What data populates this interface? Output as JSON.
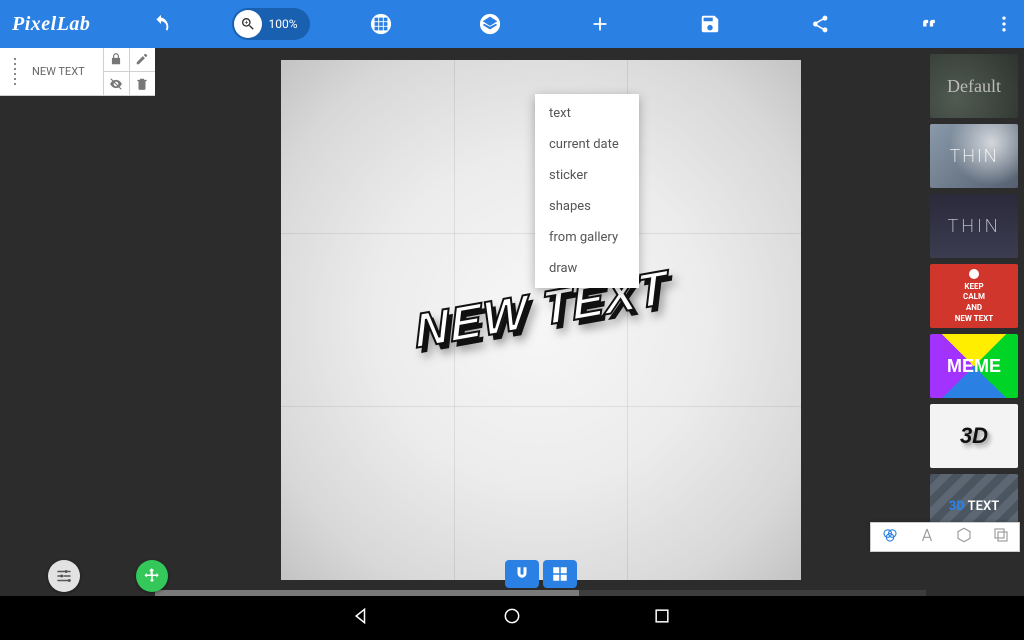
{
  "app": {
    "name": "PixelLab"
  },
  "toolbar": {
    "zoom_label": "100%"
  },
  "add_menu": {
    "items": [
      "text",
      "current date",
      "sticker",
      "shapes",
      "from gallery",
      "draw"
    ]
  },
  "layers": {
    "items": [
      {
        "name": "NEW TEXT"
      }
    ]
  },
  "canvas": {
    "main_text": "NEW TEXT"
  },
  "presets": {
    "default": "Default",
    "thin1": "THIN",
    "thin2": "THIN",
    "keep_line1": "KEEP",
    "keep_line2": "CALM",
    "keep_line3": "AND",
    "keep_line4": "NEW TEXT",
    "meme": "MEME",
    "three_d": "3D",
    "textstripe_prefix": "3D",
    "textstripe_suffix": "TEXT"
  }
}
